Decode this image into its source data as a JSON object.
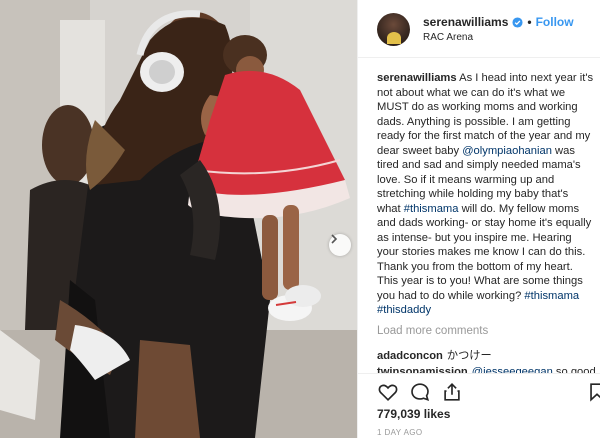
{
  "post": {
    "username": "serenawilliams",
    "follow_label": "Follow",
    "separator": "•",
    "location": "RAC Arena"
  },
  "caption": {
    "username": "serenawilliams",
    "part1": "As I head into next year it's not about what we can do it's what we MUST do as working moms and working dads. Anything is possible. I am getting ready for the first match of the year and my dear sweet baby ",
    "mention": "@olympiaohanian",
    "part2": " was tired and sad and simply needed mama's love. So if it means warming up and stretching while holding my baby that's what ",
    "hashtag1": "#thismama",
    "part3": " will do. My fellow moms and dads working- or stay home it's equally as intense- but you inspire me. Hearing your stories makes me know I can do this. Thank you from the bottom of my heart. This year is to you! What are some things you had to do while working? ",
    "hashtag2": "#thismama",
    "hashtag3": "#thisdaddy"
  },
  "comments": {
    "load_more": "Load more comments",
    "items": [
      {
        "username": "adadconcon",
        "text": "かつけー"
      },
      {
        "username": "twinsonamission",
        "mention": "@jesseegeegan",
        "text": "so good"
      }
    ]
  },
  "stats": {
    "likes": "779,039 likes",
    "time": "1 DAY AGO"
  },
  "icons": {
    "like": "heart-icon",
    "comment": "comment-icon",
    "share": "share-icon",
    "save": "bookmark-icon",
    "next": "chevron-right-icon",
    "verified": "verified-badge-icon"
  },
  "colors": {
    "link": "#3897f0",
    "hashtag": "#003569",
    "muted": "#999999",
    "dress": "#d6313d"
  }
}
